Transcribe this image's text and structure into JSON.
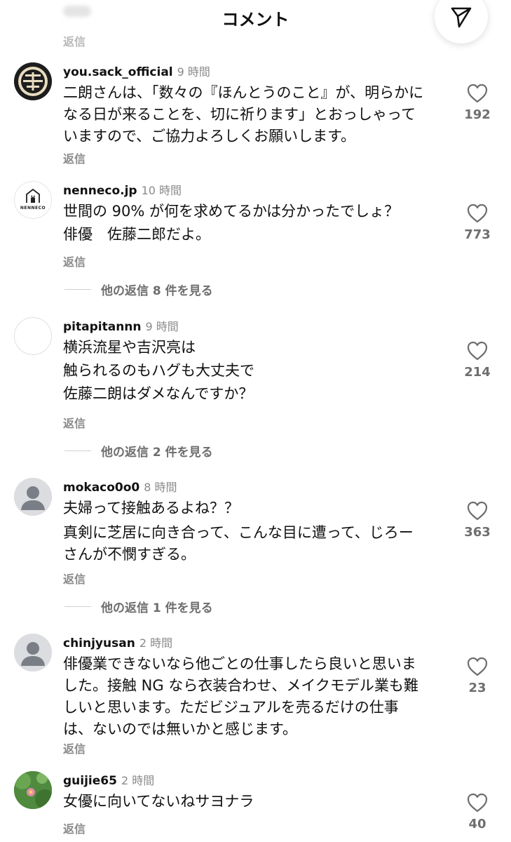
{
  "header": {
    "title": "コメント",
    "prev_reply_label": "返信"
  },
  "comments": [
    {
      "username": "you.sack_official",
      "time": "9 時間",
      "lines": [
        "二朗さんは、「数々の『ほんとうのこと』が、明らかに",
        "なる日が来ることを、切に祈ります」とおっしゃって",
        "いますので、ご協力よろしくお願いします。"
      ],
      "reply": "返信",
      "likes": "192"
    },
    {
      "username": "nenneco.jp",
      "time": "10 時間",
      "avatar_text": "NENNECO",
      "lines": [
        "世間の 90% が何を求めてるかは分かったでしょ？",
        "俳優　佐藤二郎だよ。"
      ],
      "reply": "返信",
      "likes": "773",
      "view_more": "他の返信 8 件を見る"
    },
    {
      "username": "pitapitannn",
      "time": "9 時間",
      "lines": [
        "横浜流星や吉沢亮は",
        "触られるのもハグも大丈夫で",
        "佐藤二朗はダメなんですか？"
      ],
      "reply": "返信",
      "likes": "214",
      "view_more": "他の返信 2 件を見る"
    },
    {
      "username": "mokaco0o0",
      "time": "8 時間",
      "lines": [
        "夫婦って接触あるよね？？",
        "真剣に芝居に向き合って、こんな目に遭って、じろー",
        "さんが不憫すぎる。"
      ],
      "reply": "返信",
      "likes": "363",
      "view_more": "他の返信 1 件を見る"
    },
    {
      "username": "chinjyusan",
      "time": "2 時間",
      "lines": [
        "俳優業できないなら他ごとの仕事したら良いと思いま",
        "した。接触 NG なら衣装合わせ、メイクモデル業も難",
        "しいと思います。ただビジュアルを売るだけの仕事",
        "は、ないのでは無いかと感じます。"
      ],
      "reply": "返信",
      "likes": "23"
    },
    {
      "username": "guijie65",
      "time": "2 時間",
      "lines": [
        "女優に向いてないねサヨナラ"
      ],
      "reply": "返信",
      "likes": "40"
    }
  ],
  "icons": {
    "send": "send-icon",
    "like": "heart-outline-icon",
    "default_avatar": "person-silhouette-icon"
  }
}
